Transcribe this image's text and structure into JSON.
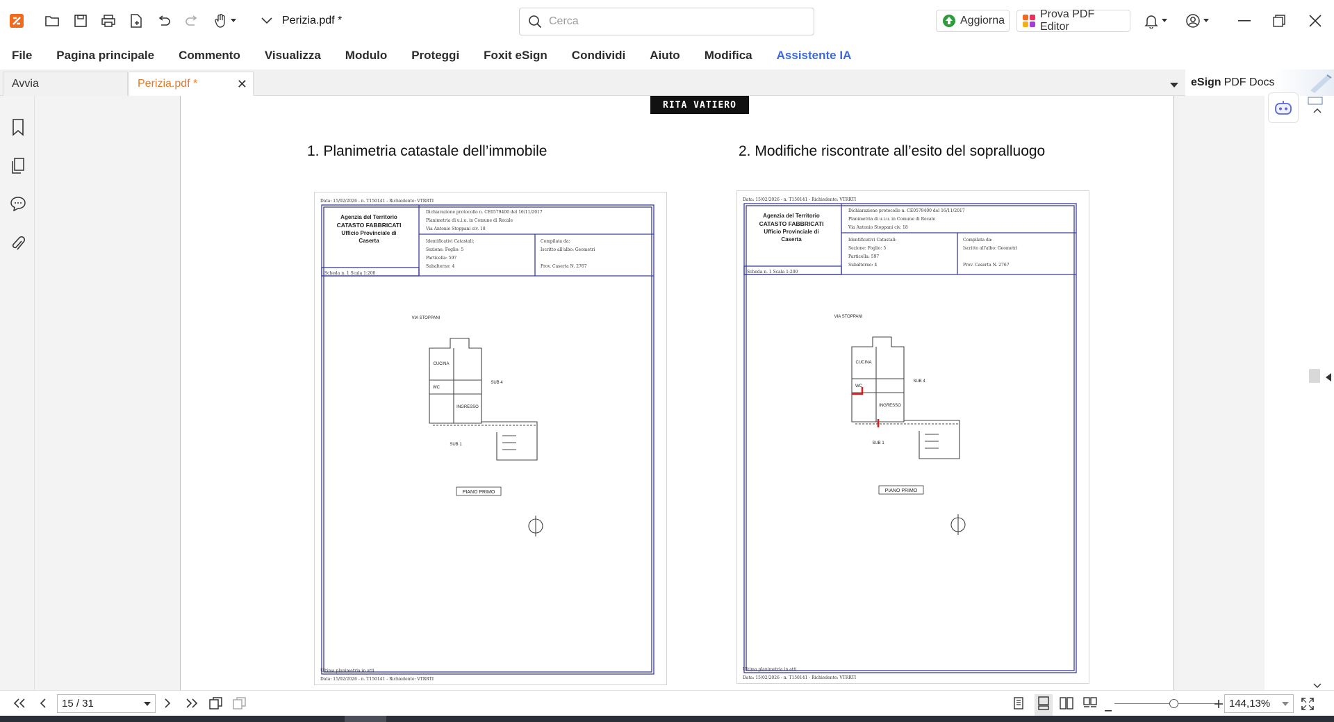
{
  "window": {
    "title": "Perizia.pdf *"
  },
  "search": {
    "placeholder": "Cerca"
  },
  "toolbar": {
    "update_label": "Aggiorna",
    "pdf_editor_label": "Prova PDF Editor"
  },
  "menu": {
    "items": [
      "File",
      "Pagina principale",
      "Commento",
      "Visualizza",
      "Modulo",
      "Proteggi",
      "Foxit eSign",
      "Condividi",
      "Aiuto",
      "Modifica",
      "Assistente IA"
    ]
  },
  "tabs": {
    "start": "Avvia",
    "active": "Perizia.pdf *"
  },
  "esign": {
    "brand": "eSign",
    "suffix": "PDF Docs"
  },
  "document": {
    "signature": "RITA VATIERO",
    "heading1": "1.    Planimetria catastale dell’immobile",
    "heading2": "2.  Modifiche riscontrate all’esito del sopralluogo",
    "plan": {
      "agency": "Agenzia del Territorio",
      "dept": "CATASTO FABBRICATI",
      "office": "Ufficio Provinciale di",
      "city": "Caserta",
      "street_label": "VIA STOPPANI",
      "floor_label": "PIANO PRIMO",
      "rooms": [
        "CUCINA",
        "WC",
        "INGRESSO",
        "SUB 4",
        "SUB 1"
      ]
    }
  },
  "status": {
    "page": "15 / 31",
    "zoom": "144,13%"
  },
  "colors": {
    "accent": "#e4792a",
    "ai": "#3c68d8",
    "plan_line": "#3a3d9a",
    "edit_red": "#d81e1e"
  }
}
